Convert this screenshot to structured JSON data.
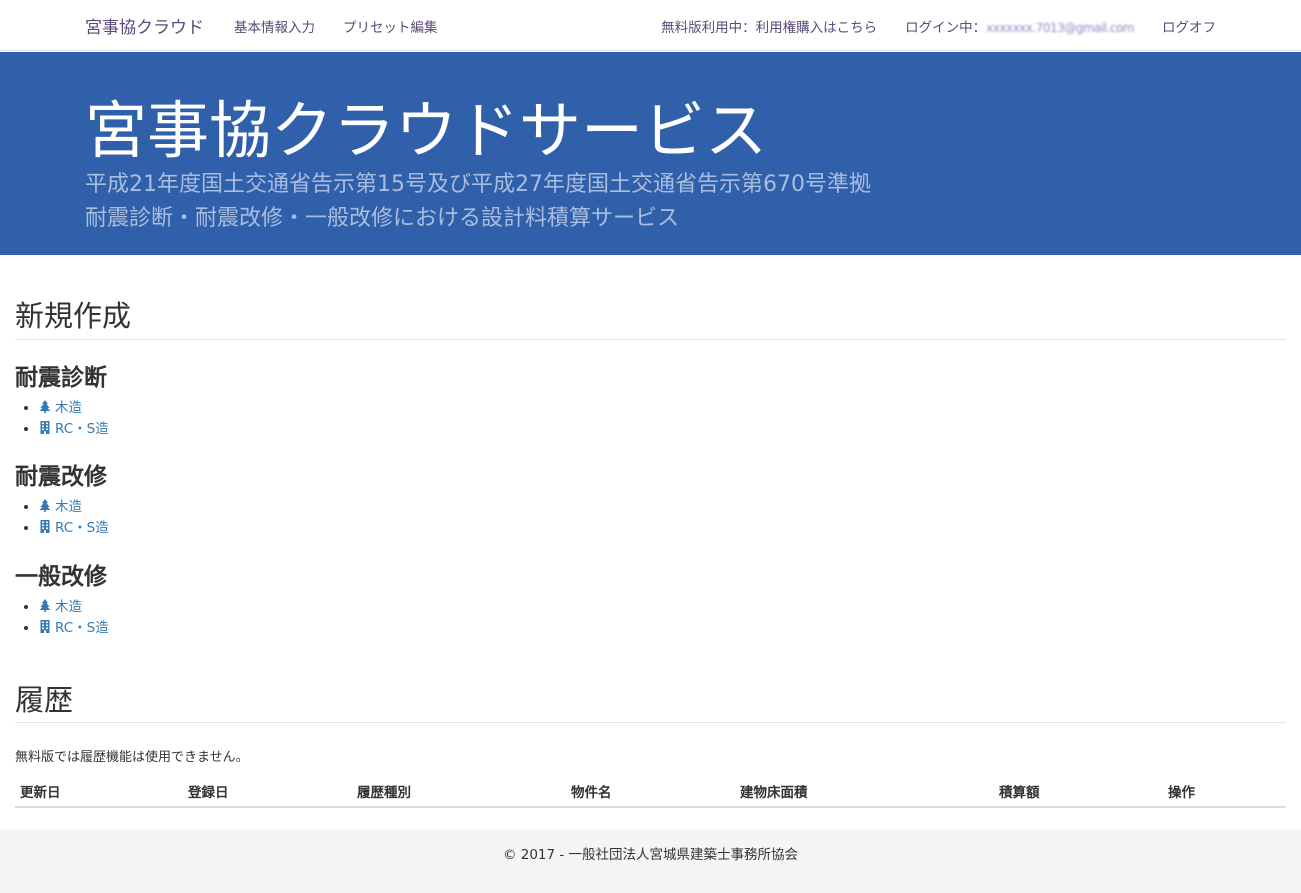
{
  "navbar": {
    "brand": "宮事協クラウド",
    "links": [
      "基本情報入力",
      "プリセット編集"
    ],
    "purchase_link": "無料版利用中：利用権購入はこちら",
    "login_label": "ログイン中：",
    "login_email": "xxxxxxx.7013@gmail.com",
    "logoff": "ログオフ"
  },
  "jumbotron": {
    "title": "宮事協クラウドサービス",
    "subtitle_line1": "平成21年度国土交通省告示第15号及び平成27年度国土交通省告示第670号準拠",
    "subtitle_line2": "耐震診断・耐震改修・一般改修における設計料積算サービス"
  },
  "new_section": {
    "title": "新規作成",
    "groups": [
      {
        "title": "耐震診断",
        "items": [
          {
            "icon": "tree-icon",
            "label": "木造"
          },
          {
            "icon": "building-icon",
            "label": "RC・S造"
          }
        ]
      },
      {
        "title": "耐震改修",
        "items": [
          {
            "icon": "tree-icon",
            "label": "木造"
          },
          {
            "icon": "building-icon",
            "label": "RC・S造"
          }
        ]
      },
      {
        "title": "一般改修",
        "items": [
          {
            "icon": "tree-icon",
            "label": "木造"
          },
          {
            "icon": "building-icon",
            "label": "RC・S造"
          }
        ]
      }
    ]
  },
  "history_section": {
    "title": "履歴",
    "note": "無料版では履歴機能は使用できません。",
    "columns": [
      "更新日",
      "登録日",
      "履歴種別",
      "物件名",
      "建物床面積",
      "積算額",
      "操作"
    ]
  },
  "footer": {
    "text": "© 2017 - 一般社団法人宮城県建築士事務所協会"
  },
  "colors": {
    "jumbotron_bg": "#3060aa",
    "link": "#337ab7",
    "nav_text": "#5a4a78"
  }
}
